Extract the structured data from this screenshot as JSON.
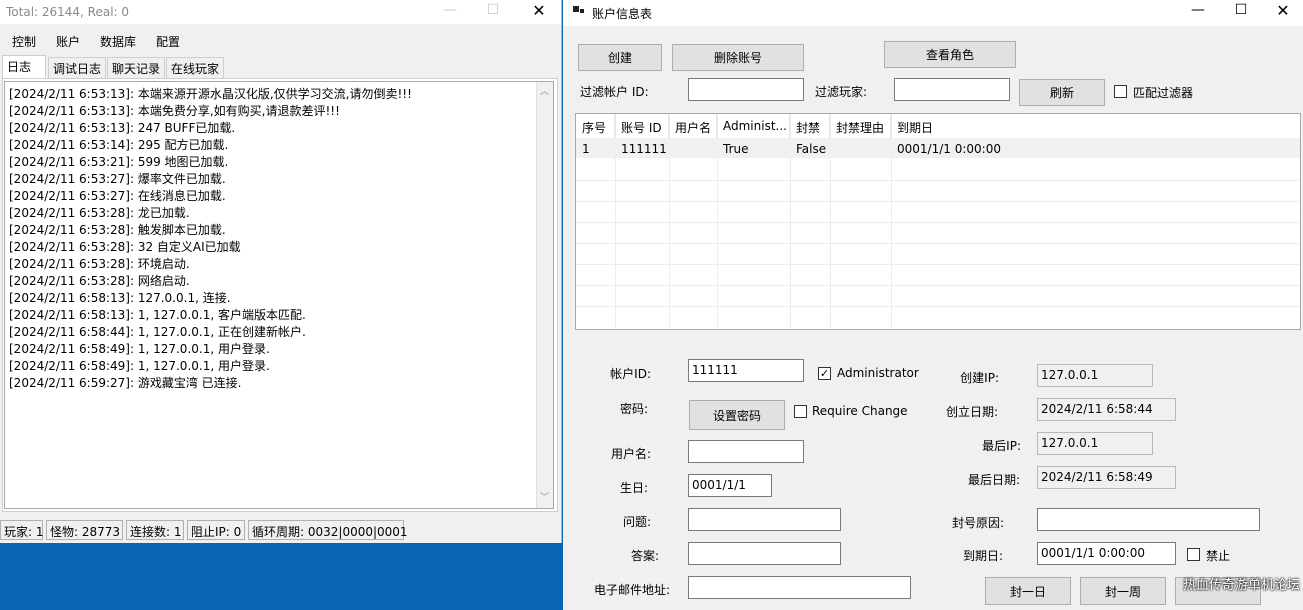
{
  "left_window": {
    "title": "Total: 26144, Real: 0",
    "menu": [
      "控制",
      "账户",
      "数据库",
      "配置"
    ],
    "tabs": [
      "日志",
      "调试日志",
      "聊天记录",
      "在线玩家"
    ],
    "log_lines": [
      "[2024/2/11 6:53:13]: 本端来源开源水晶汉化版,仅供学习交流,请勿倒卖!!!",
      "[2024/2/11 6:53:13]: 本端免费分享,如有购买,请退款差评!!!",
      "[2024/2/11 6:53:13]: 247 BUFF已加载.",
      "[2024/2/11 6:53:14]: 295 配方已加载.",
      "[2024/2/11 6:53:21]: 599 地图已加载.",
      "[2024/2/11 6:53:27]: 爆率文件已加载.",
      "[2024/2/11 6:53:27]: 在线消息已加载.",
      "[2024/2/11 6:53:28]: 龙已加载.",
      "[2024/2/11 6:53:28]: 触发脚本已加载.",
      "[2024/2/11 6:53:28]: 32 自定义AI已加载",
      "[2024/2/11 6:53:28]: 环境启动.",
      "[2024/2/11 6:53:28]: 网络启动.",
      "[2024/2/11 6:58:13]: 127.0.0.1, 连接.",
      "[2024/2/11 6:58:13]: 1, 127.0.0.1, 客户端版本匹配.",
      "[2024/2/11 6:58:44]: 1, 127.0.0.1, 正在创建新帐户.",
      "[2024/2/11 6:58:49]: 1, 127.0.0.1, 用户登录.",
      "[2024/2/11 6:58:49]: 1, 127.0.0.1, 用户登录.",
      "[2024/2/11 6:59:27]: 游戏藏宝湾 已连接."
    ],
    "status": [
      "玩家: 1",
      "怪物: 28773",
      "连接数: 1",
      "阻止IP: 0",
      "循环周期: 0032|0000|0001"
    ]
  },
  "right_window": {
    "title": "账户信息表",
    "buttons": {
      "create": "创建",
      "delete": "删除账号",
      "view_roles": "查看角色",
      "refresh": "刷新",
      "set_password": "设置密码",
      "ban_day": "封一日",
      "ban_week": "封一周"
    },
    "filters": {
      "account_id_label": "过滤帐户 ID:",
      "player_label": "过滤玩家:",
      "match_filter_label": "匹配过滤器"
    },
    "grid": {
      "columns": [
        "序号",
        "账号 ID",
        "用户名",
        "Administ...",
        "封禁",
        "封禁理由",
        "到期日"
      ],
      "rows": [
        [
          "1",
          "111111",
          "",
          "True",
          "False",
          "",
          "0001/1/1 0:00:00"
        ]
      ]
    },
    "form": {
      "account_id_label": "帐户ID:",
      "account_id": "111111",
      "administrator_label": "Administrator",
      "administrator_checked": true,
      "password_label": "密码:",
      "require_change_label": "Require Change",
      "require_change_checked": false,
      "username_label": "用户名:",
      "username": "",
      "birthday_label": "生日:",
      "birthday": "0001/1/1",
      "question_label": "问题:",
      "question": "",
      "answer_label": "答案:",
      "answer": "",
      "email_label": "电子邮件地址:",
      "email": "",
      "create_ip_label": "创建IP:",
      "create_ip": "127.0.0.1",
      "create_date_label": "创立日期:",
      "create_date": "2024/2/11 6:58:44",
      "last_ip_label": "最后IP:",
      "last_ip": "127.0.0.1",
      "last_date_label": "最后日期:",
      "last_date": "2024/2/11 6:58:49",
      "ban_reason_label": "封号原因:",
      "ban_reason": "",
      "expiry_label": "到期日:",
      "expiry": "0001/1/1 0:00:00",
      "banned_label": "禁止",
      "banned_checked": false
    },
    "watermark": "热血传奇游单机论坛"
  }
}
